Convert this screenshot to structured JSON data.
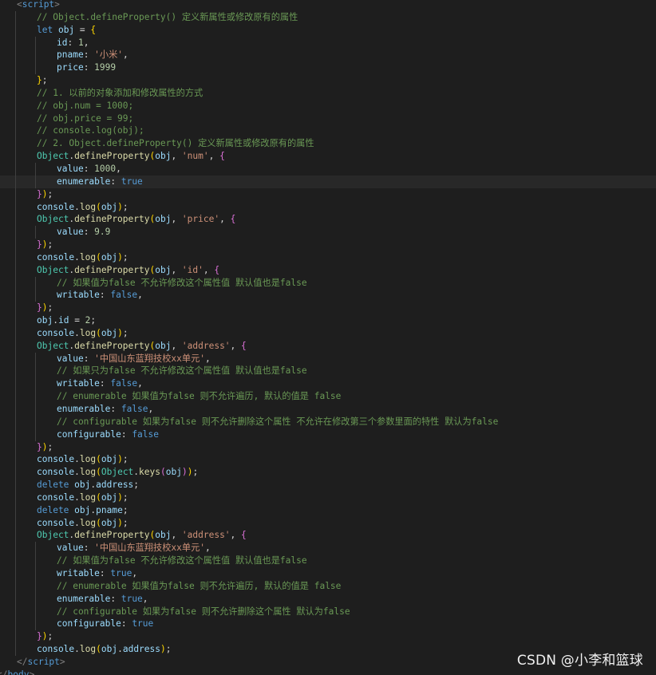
{
  "editor": {
    "language": "javascript",
    "active_line": 14,
    "colors": {
      "background": "#1e1e1e",
      "keyword": "#569cd6",
      "variable": "#9cdcfe",
      "type": "#4ec9b0",
      "function": "#dcdcaa",
      "string": "#ce9178",
      "number": "#b5cea8",
      "comment": "#6a9955",
      "bracket_level_1": "#ffd700",
      "bracket_level_2": "#da70d6",
      "bracket_level_3": "#179fff"
    },
    "lines": [
      {
        "indent": 1,
        "tokens": [
          [
            "tag",
            "<"
          ],
          [
            "tagname",
            "script"
          ],
          [
            "tag",
            ">"
          ]
        ]
      },
      {
        "indent": 2,
        "tokens": [
          [
            "cmt",
            "// Object.defineProperty() 定义新属性或修改原有的属性"
          ]
        ]
      },
      {
        "indent": 2,
        "tokens": [
          [
            "kw",
            "let"
          ],
          [
            "pun",
            " "
          ],
          [
            "var",
            "obj"
          ],
          [
            "pun",
            " = "
          ],
          [
            "br1",
            "{"
          ]
        ]
      },
      {
        "indent": 3,
        "tokens": [
          [
            "var",
            "id"
          ],
          [
            "pun",
            ": "
          ],
          [
            "num",
            "1"
          ],
          [
            "pun",
            ","
          ]
        ]
      },
      {
        "indent": 3,
        "tokens": [
          [
            "var",
            "pname"
          ],
          [
            "pun",
            ": "
          ],
          [
            "str",
            "'小米'"
          ],
          [
            "pun",
            ","
          ]
        ]
      },
      {
        "indent": 3,
        "tokens": [
          [
            "var",
            "price"
          ],
          [
            "pun",
            ": "
          ],
          [
            "num",
            "1999"
          ]
        ]
      },
      {
        "indent": 2,
        "tokens": [
          [
            "br1",
            "}"
          ],
          [
            "pun",
            ";"
          ]
        ]
      },
      {
        "indent": 2,
        "tokens": [
          [
            "cmt",
            "// 1. 以前的对象添加和修改属性的方式"
          ]
        ]
      },
      {
        "indent": 2,
        "tokens": [
          [
            "cmt",
            "// obj.num = 1000;"
          ]
        ]
      },
      {
        "indent": 2,
        "tokens": [
          [
            "cmt",
            "// obj.price = 99;"
          ]
        ]
      },
      {
        "indent": 2,
        "tokens": [
          [
            "cmt",
            "// console.log(obj);"
          ]
        ]
      },
      {
        "indent": 2,
        "tokens": [
          [
            "cmt",
            "// 2. Object.defineProperty() 定义新属性或修改原有的属性"
          ]
        ]
      },
      {
        "indent": 2,
        "tokens": [
          [
            "obj",
            "Object"
          ],
          [
            "pun",
            "."
          ],
          [
            "fn",
            "defineProperty"
          ],
          [
            "br1",
            "("
          ],
          [
            "var",
            "obj"
          ],
          [
            "pun",
            ", "
          ],
          [
            "str",
            "'num'"
          ],
          [
            "pun",
            ", "
          ],
          [
            "br2",
            "{"
          ]
        ]
      },
      {
        "indent": 3,
        "tokens": [
          [
            "var",
            "value"
          ],
          [
            "pun",
            ": "
          ],
          [
            "num",
            "1000"
          ],
          [
            "pun",
            ","
          ]
        ]
      },
      {
        "indent": 3,
        "tokens": [
          [
            "var",
            "enumerable"
          ],
          [
            "pun",
            ": "
          ],
          [
            "kw",
            "true"
          ]
        ]
      },
      {
        "indent": 2,
        "tokens": [
          [
            "br2",
            "}"
          ],
          [
            "br1",
            ")"
          ],
          [
            "pun",
            ";"
          ]
        ]
      },
      {
        "indent": 2,
        "tokens": [
          [
            "var",
            "console"
          ],
          [
            "pun",
            "."
          ],
          [
            "fn",
            "log"
          ],
          [
            "br1",
            "("
          ],
          [
            "var",
            "obj"
          ],
          [
            "br1",
            ")"
          ],
          [
            "pun",
            ";"
          ]
        ]
      },
      {
        "indent": 2,
        "tokens": [
          [
            "obj",
            "Object"
          ],
          [
            "pun",
            "."
          ],
          [
            "fn",
            "defineProperty"
          ],
          [
            "br1",
            "("
          ],
          [
            "var",
            "obj"
          ],
          [
            "pun",
            ", "
          ],
          [
            "str",
            "'price'"
          ],
          [
            "pun",
            ", "
          ],
          [
            "br2",
            "{"
          ]
        ]
      },
      {
        "indent": 3,
        "tokens": [
          [
            "var",
            "value"
          ],
          [
            "pun",
            ": "
          ],
          [
            "num",
            "9.9"
          ]
        ]
      },
      {
        "indent": 2,
        "tokens": [
          [
            "br2",
            "}"
          ],
          [
            "br1",
            ")"
          ],
          [
            "pun",
            ";"
          ]
        ]
      },
      {
        "indent": 2,
        "tokens": [
          [
            "var",
            "console"
          ],
          [
            "pun",
            "."
          ],
          [
            "fn",
            "log"
          ],
          [
            "br1",
            "("
          ],
          [
            "var",
            "obj"
          ],
          [
            "br1",
            ")"
          ],
          [
            "pun",
            ";"
          ]
        ]
      },
      {
        "indent": 2,
        "tokens": [
          [
            "obj",
            "Object"
          ],
          [
            "pun",
            "."
          ],
          [
            "fn",
            "defineProperty"
          ],
          [
            "br1",
            "("
          ],
          [
            "var",
            "obj"
          ],
          [
            "pun",
            ", "
          ],
          [
            "str",
            "'id'"
          ],
          [
            "pun",
            ", "
          ],
          [
            "br2",
            "{"
          ]
        ]
      },
      {
        "indent": 3,
        "tokens": [
          [
            "cmt",
            "// 如果值为false 不允许修改这个属性值 默认值也是false"
          ]
        ]
      },
      {
        "indent": 3,
        "tokens": [
          [
            "var",
            "writable"
          ],
          [
            "pun",
            ": "
          ],
          [
            "kw",
            "false"
          ],
          [
            "pun",
            ","
          ]
        ]
      },
      {
        "indent": 2,
        "tokens": [
          [
            "br2",
            "}"
          ],
          [
            "br1",
            ")"
          ],
          [
            "pun",
            ";"
          ]
        ]
      },
      {
        "indent": 2,
        "tokens": [
          [
            "var",
            "obj"
          ],
          [
            "pun",
            "."
          ],
          [
            "var",
            "id"
          ],
          [
            "pun",
            " = "
          ],
          [
            "num",
            "2"
          ],
          [
            "pun",
            ";"
          ]
        ]
      },
      {
        "indent": 2,
        "tokens": [
          [
            "var",
            "console"
          ],
          [
            "pun",
            "."
          ],
          [
            "fn",
            "log"
          ],
          [
            "br1",
            "("
          ],
          [
            "var",
            "obj"
          ],
          [
            "br1",
            ")"
          ],
          [
            "pun",
            ";"
          ]
        ]
      },
      {
        "indent": 2,
        "tokens": [
          [
            "obj",
            "Object"
          ],
          [
            "pun",
            "."
          ],
          [
            "fn",
            "defineProperty"
          ],
          [
            "br1",
            "("
          ],
          [
            "var",
            "obj"
          ],
          [
            "pun",
            ", "
          ],
          [
            "str",
            "'address'"
          ],
          [
            "pun",
            ", "
          ],
          [
            "br2",
            "{"
          ]
        ]
      },
      {
        "indent": 3,
        "tokens": [
          [
            "var",
            "value"
          ],
          [
            "pun",
            ": "
          ],
          [
            "str",
            "'中国山东蓝翔技校xx单元'"
          ],
          [
            "pun",
            ","
          ]
        ]
      },
      {
        "indent": 3,
        "tokens": [
          [
            "cmt",
            "// 如果只为false 不允许修改这个属性值 默认值也是false"
          ]
        ]
      },
      {
        "indent": 3,
        "tokens": [
          [
            "var",
            "writable"
          ],
          [
            "pun",
            ": "
          ],
          [
            "kw",
            "false"
          ],
          [
            "pun",
            ","
          ]
        ]
      },
      {
        "indent": 3,
        "tokens": [
          [
            "cmt",
            "// enumerable 如果值为false 则不允许遍历, 默认的值是 false"
          ]
        ]
      },
      {
        "indent": 3,
        "tokens": [
          [
            "var",
            "enumerable"
          ],
          [
            "pun",
            ": "
          ],
          [
            "kw",
            "false"
          ],
          [
            "pun",
            ","
          ]
        ]
      },
      {
        "indent": 3,
        "tokens": [
          [
            "cmt",
            "// configurable 如果为false 则不允许删除这个属性 不允许在修改第三个参数里面的特性 默认为false"
          ]
        ]
      },
      {
        "indent": 3,
        "tokens": [
          [
            "var",
            "configurable"
          ],
          [
            "pun",
            ": "
          ],
          [
            "kw",
            "false"
          ]
        ]
      },
      {
        "indent": 2,
        "tokens": [
          [
            "br2",
            "}"
          ],
          [
            "br1",
            ")"
          ],
          [
            "pun",
            ";"
          ]
        ]
      },
      {
        "indent": 2,
        "tokens": [
          [
            "var",
            "console"
          ],
          [
            "pun",
            "."
          ],
          [
            "fn",
            "log"
          ],
          [
            "br1",
            "("
          ],
          [
            "var",
            "obj"
          ],
          [
            "br1",
            ")"
          ],
          [
            "pun",
            ";"
          ]
        ]
      },
      {
        "indent": 2,
        "tokens": [
          [
            "var",
            "console"
          ],
          [
            "pun",
            "."
          ],
          [
            "fn",
            "log"
          ],
          [
            "br1",
            "("
          ],
          [
            "obj",
            "Object"
          ],
          [
            "pun",
            "."
          ],
          [
            "fn",
            "keys"
          ],
          [
            "br2",
            "("
          ],
          [
            "var",
            "obj"
          ],
          [
            "br2",
            ")"
          ],
          [
            "br1",
            ")"
          ],
          [
            "pun",
            ";"
          ]
        ]
      },
      {
        "indent": 2,
        "tokens": [
          [
            "kw",
            "delete"
          ],
          [
            "pun",
            " "
          ],
          [
            "var",
            "obj"
          ],
          [
            "pun",
            "."
          ],
          [
            "var",
            "address"
          ],
          [
            "pun",
            ";"
          ]
        ]
      },
      {
        "indent": 2,
        "tokens": [
          [
            "var",
            "console"
          ],
          [
            "pun",
            "."
          ],
          [
            "fn",
            "log"
          ],
          [
            "br1",
            "("
          ],
          [
            "var",
            "obj"
          ],
          [
            "br1",
            ")"
          ],
          [
            "pun",
            ";"
          ]
        ]
      },
      {
        "indent": 2,
        "tokens": [
          [
            "kw",
            "delete"
          ],
          [
            "pun",
            " "
          ],
          [
            "var",
            "obj"
          ],
          [
            "pun",
            "."
          ],
          [
            "var",
            "pname"
          ],
          [
            "pun",
            ";"
          ]
        ]
      },
      {
        "indent": 2,
        "tokens": [
          [
            "var",
            "console"
          ],
          [
            "pun",
            "."
          ],
          [
            "fn",
            "log"
          ],
          [
            "br1",
            "("
          ],
          [
            "var",
            "obj"
          ],
          [
            "br1",
            ")"
          ],
          [
            "pun",
            ";"
          ]
        ]
      },
      {
        "indent": 2,
        "tokens": [
          [
            "obj",
            "Object"
          ],
          [
            "pun",
            "."
          ],
          [
            "fn",
            "defineProperty"
          ],
          [
            "br1",
            "("
          ],
          [
            "var",
            "obj"
          ],
          [
            "pun",
            ", "
          ],
          [
            "str",
            "'address'"
          ],
          [
            "pun",
            ", "
          ],
          [
            "br2",
            "{"
          ]
        ]
      },
      {
        "indent": 3,
        "tokens": [
          [
            "var",
            "value"
          ],
          [
            "pun",
            ": "
          ],
          [
            "str",
            "'中国山东蓝翔技校xx单元'"
          ],
          [
            "pun",
            ","
          ]
        ]
      },
      {
        "indent": 3,
        "tokens": [
          [
            "cmt",
            "// 如果值为false 不允许修改这个属性值 默认值也是false"
          ]
        ]
      },
      {
        "indent": 3,
        "tokens": [
          [
            "var",
            "writable"
          ],
          [
            "pun",
            ": "
          ],
          [
            "kw",
            "true"
          ],
          [
            "pun",
            ","
          ]
        ]
      },
      {
        "indent": 3,
        "tokens": [
          [
            "cmt",
            "// enumerable 如果值为false 则不允许遍历, 默认的值是 false"
          ]
        ]
      },
      {
        "indent": 3,
        "tokens": [
          [
            "var",
            "enumerable"
          ],
          [
            "pun",
            ": "
          ],
          [
            "kw",
            "true"
          ],
          [
            "pun",
            ","
          ]
        ]
      },
      {
        "indent": 3,
        "tokens": [
          [
            "cmt",
            "// configurable 如果为false 则不允许删除这个属性 默认为false"
          ]
        ]
      },
      {
        "indent": 3,
        "tokens": [
          [
            "var",
            "configurable"
          ],
          [
            "pun",
            ": "
          ],
          [
            "kw",
            "true"
          ]
        ]
      },
      {
        "indent": 2,
        "tokens": [
          [
            "br2",
            "}"
          ],
          [
            "br1",
            ")"
          ],
          [
            "pun",
            ";"
          ]
        ]
      },
      {
        "indent": 2,
        "tokens": [
          [
            "var",
            "console"
          ],
          [
            "pun",
            "."
          ],
          [
            "fn",
            "log"
          ],
          [
            "br1",
            "("
          ],
          [
            "var",
            "obj"
          ],
          [
            "pun",
            "."
          ],
          [
            "var",
            "address"
          ],
          [
            "br1",
            ")"
          ],
          [
            "pun",
            ";"
          ]
        ]
      },
      {
        "indent": 1,
        "tokens": [
          [
            "tag",
            "</"
          ],
          [
            "tagname",
            "script"
          ],
          [
            "tag",
            ">"
          ]
        ]
      },
      {
        "indent": 0,
        "tokens": [
          [
            "tag",
            "</"
          ],
          [
            "tagname",
            "body"
          ],
          [
            "tag",
            ">"
          ]
        ]
      }
    ]
  },
  "watermark": "CSDN @小李和篮球"
}
